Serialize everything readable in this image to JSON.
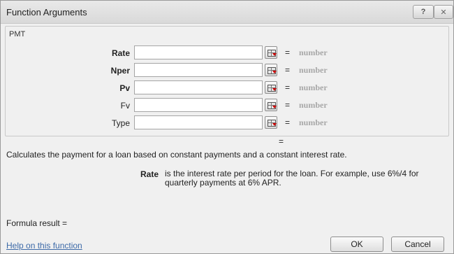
{
  "window": {
    "title": "Function Arguments",
    "help_symbol": "?",
    "close_symbol": "✕"
  },
  "function": {
    "name": "PMT",
    "arguments": [
      {
        "label": "Rate",
        "required": true,
        "value": "",
        "equals": "=",
        "hint": "number"
      },
      {
        "label": "Nper",
        "required": true,
        "value": "",
        "equals": "=",
        "hint": "number"
      },
      {
        "label": "Pv",
        "required": true,
        "value": "",
        "equals": "=",
        "hint": "number"
      },
      {
        "label": "Fv",
        "required": false,
        "value": "",
        "equals": "=",
        "hint": "number"
      },
      {
        "label": "Type",
        "required": false,
        "value": "",
        "equals": "=",
        "hint": "number"
      }
    ],
    "result_equals": "=",
    "description": "Calculates the payment for a loan based on constant payments and a constant interest rate.",
    "current_arg_name": "Rate",
    "current_arg_description": "is the interest rate per period for the loan. For example, use 6%/4 for quarterly payments at 6% APR."
  },
  "footer": {
    "formula_result_label": "Formula result =",
    "help_link": "Help on this function",
    "ok_label": "OK",
    "cancel_label": "Cancel"
  }
}
